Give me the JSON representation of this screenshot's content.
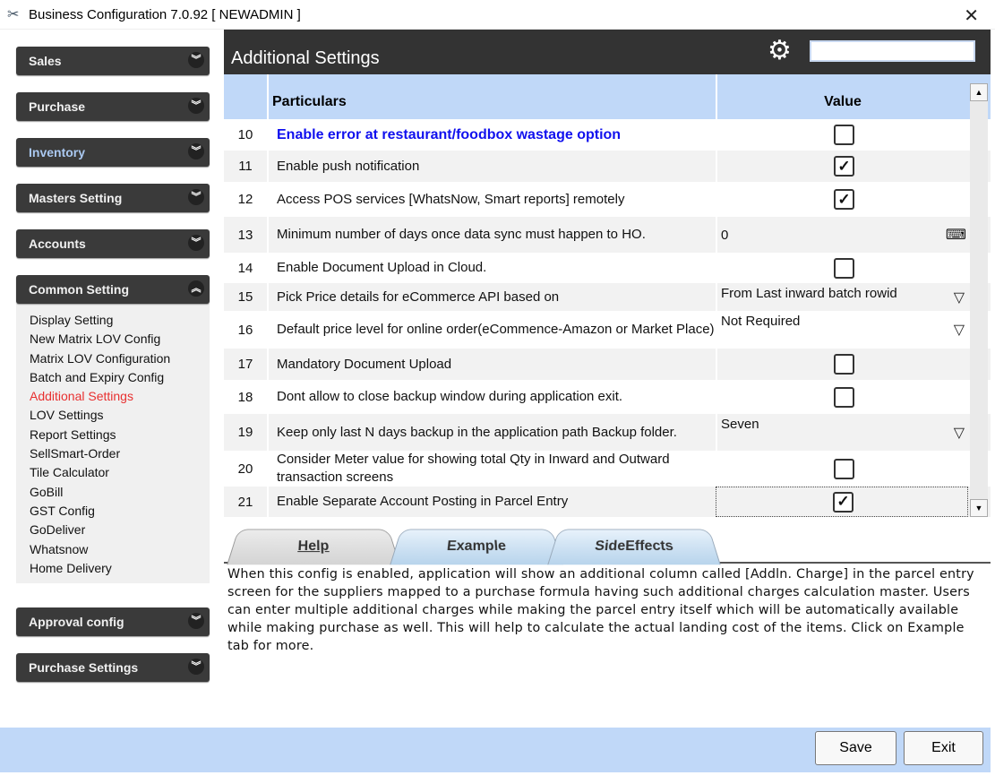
{
  "window": {
    "title": "Business Configuration 7.0.92 [ NEWADMIN ]",
    "close": "✕"
  },
  "sidebar": {
    "groups_top": [
      {
        "label": "Sales"
      },
      {
        "label": "Purchase"
      },
      {
        "label": "Inventory"
      },
      {
        "label": "Masters Setting"
      },
      {
        "label": "Accounts"
      },
      {
        "label": "Common Setting"
      }
    ],
    "common_items": [
      "Display Setting",
      "New Matrix LOV Config",
      "Matrix LOV Configuration",
      "Batch and Expiry Config",
      "Additional Settings",
      "LOV Settings",
      "Report Settings",
      "SellSmart-Order",
      "Tile Calculator",
      "GoBill",
      "GST Config",
      "GoDeliver",
      "Whatsnow",
      "Home Delivery"
    ],
    "active_item": "Additional Settings",
    "groups_bottom": [
      {
        "label": "Approval config"
      },
      {
        "label": "Purchase Settings"
      }
    ]
  },
  "main": {
    "title": "Additional Settings",
    "search": "",
    "columns": {
      "num": "",
      "particulars": "Particulars",
      "value": "Value"
    },
    "rows": [
      {
        "no": "10",
        "text": "Enable error at restaurant/foodbox wastage option",
        "type": "check",
        "checked": false,
        "highlight": true
      },
      {
        "no": "11",
        "text": "Enable push notification",
        "type": "check",
        "checked": true
      },
      {
        "no": "12",
        "text": "Access POS services [WhatsNow, Smart reports] remotely",
        "type": "check",
        "checked": true
      },
      {
        "no": "13",
        "text": "Minimum number of days once data sync must happen to HO.",
        "type": "text",
        "value": "0"
      },
      {
        "no": "14",
        "text": "Enable Document Upload in Cloud.",
        "type": "check",
        "checked": false
      },
      {
        "no": "15",
        "text": "Pick Price details for eCommerce API based on",
        "type": "select",
        "value": "From Last inward batch rowid"
      },
      {
        "no": "16",
        "text": "Default price level for online order(eCommence-Amazon or Market Place)",
        "type": "select",
        "value": "Not Required"
      },
      {
        "no": "17",
        "text": "Mandatory Document Upload",
        "type": "check",
        "checked": false
      },
      {
        "no": "18",
        "text": "Dont allow to close backup window during application exit.",
        "type": "check",
        "checked": false
      },
      {
        "no": "19",
        "text": "Keep only last N days backup in the application path Backup folder.",
        "type": "select",
        "value": "Seven"
      },
      {
        "no": "20",
        "text": "Consider Meter value for showing total Qty in Inward and Outward transaction screens",
        "type": "check",
        "checked": false
      },
      {
        "no": "21",
        "text": "Enable Separate Account Posting in Parcel Entry",
        "type": "check",
        "checked": true
      }
    ],
    "tabs": [
      "Help",
      "Example",
      "SideEffects"
    ],
    "help_text": "When this config is enabled, application will show an additional column called [Addln. Charge] in the parcel entry screen for the suppliers mapped to a purchase formula having such additional charges calculation master. Users can enter multiple additional charges while making the parcel entry itself which will be automatically available while making purchase as well. This will help to calculate the actual landing cost of the items. Click on Example tab for more."
  },
  "footer": {
    "save": "Save",
    "exit": "Exit"
  }
}
